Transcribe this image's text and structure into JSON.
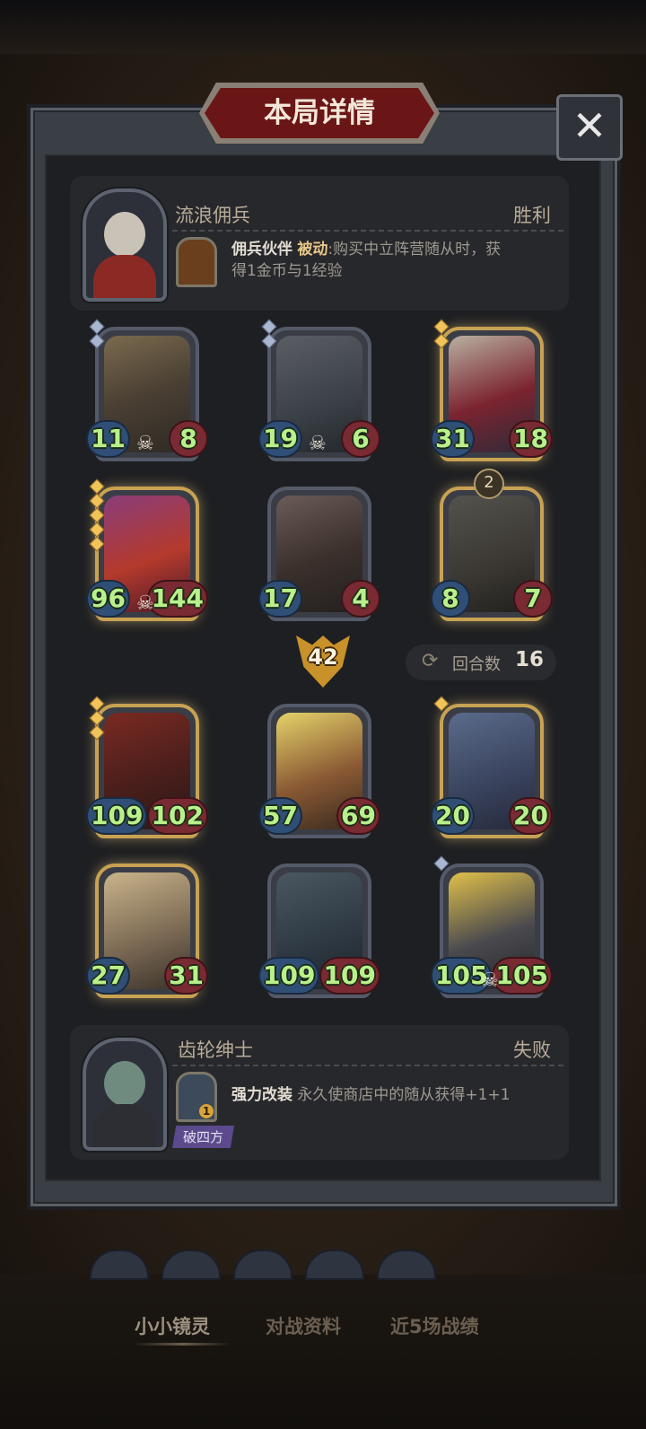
{
  "title": "本局详情",
  "close_icon": "close-icon",
  "winner": {
    "name": "流浪佣兵",
    "result": "胜利",
    "ability_name": "佣兵伙伴",
    "ability_type": "被动",
    "ability_desc_1": ":购买中立阵营随从时，获",
    "ability_desc_2": "得1金币与1经验"
  },
  "loser": {
    "name": "齿轮绅士",
    "result": "失败",
    "ability_name": "强力改装",
    "ability_desc": "永久使商店中的随从获得+1+1",
    "ability_level": "1",
    "tag": "破四方"
  },
  "winner_units": [
    {
      "atk": "11",
      "hp": "8",
      "gold": false,
      "stars": 2,
      "skull": true,
      "art": "zeppelin"
    },
    {
      "atk": "19",
      "hp": "6",
      "gold": false,
      "stars": 2,
      "skull": true,
      "art": "robot-bell"
    },
    {
      "atk": "31",
      "hp": "18",
      "gold": true,
      "stars": 2,
      "skull": false,
      "art": "clown"
    },
    {
      "atk": "96",
      "hp": "144",
      "gold": true,
      "stars": 5,
      "skull": true,
      "art": "dragon"
    },
    {
      "atk": "17",
      "hp": "4",
      "gold": false,
      "stars": 0,
      "skull": false,
      "art": "rabbit-mask"
    },
    {
      "atk": "8",
      "hp": "7",
      "gold": true,
      "stars": 0,
      "skull": false,
      "art": "shield-knight",
      "badge": "2"
    }
  ],
  "damage": "42",
  "rounds": {
    "label": "回合数",
    "value": "16"
  },
  "loser_units": [
    {
      "atk": "109",
      "hp": "102",
      "gold": true,
      "stars": 3,
      "skull": false,
      "art": "red-hood"
    },
    {
      "atk": "57",
      "hp": "69",
      "gold": false,
      "stars": 0,
      "skull": false,
      "art": "boar-warrior"
    },
    {
      "atk": "20",
      "hp": "20",
      "gold": true,
      "stars": 1,
      "skull": false,
      "art": "wizard"
    },
    {
      "atk": "27",
      "hp": "31",
      "gold": true,
      "stars": 0,
      "skull": false,
      "art": "fan-lady"
    },
    {
      "atk": "109",
      "hp": "109",
      "gold": false,
      "stars": 0,
      "skull": false,
      "art": "iron-knight"
    },
    {
      "atk": "105",
      "hp": "105",
      "gold": false,
      "stars": 1,
      "skull": true,
      "art": "lightning-bot"
    }
  ],
  "bottom_tabs": [
    "小小镜灵",
    "对战资料",
    "近5场战绩"
  ]
}
